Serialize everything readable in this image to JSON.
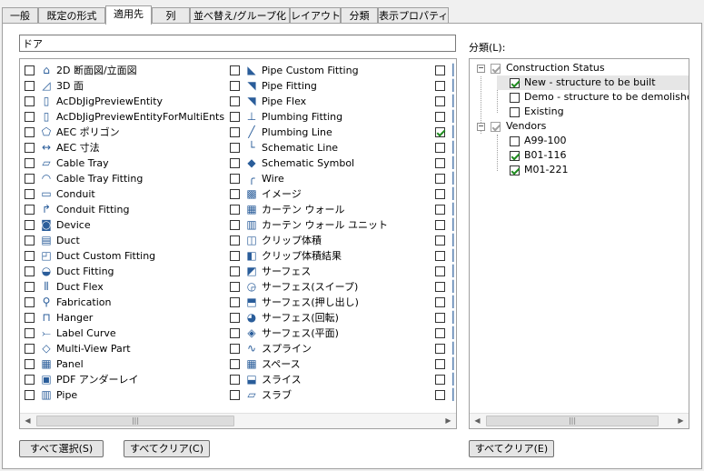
{
  "tabs": [
    {
      "label": "一般"
    },
    {
      "label": "既定の形式"
    },
    {
      "label": "適用先",
      "active": true
    },
    {
      "label": "列"
    },
    {
      "label": "並べ替え/グループ化"
    },
    {
      "label": "レイアウト"
    },
    {
      "label": "分類"
    },
    {
      "label": "表示プロパティ"
    }
  ],
  "search": {
    "value": "ドア"
  },
  "objects": {
    "col1": [
      {
        "label": "2D 断面図/立面図",
        "icon": "house-icon",
        "checked": false
      },
      {
        "label": "3D 面",
        "icon": "face-icon",
        "checked": false
      },
      {
        "label": "AcDbJigPreviewEntity",
        "icon": "document-icon",
        "checked": false
      },
      {
        "label": "AcDbJigPreviewEntityForMultiEnts",
        "icon": "document-icon",
        "checked": false
      },
      {
        "label": "AEC ポリゴン",
        "icon": "polygon-icon",
        "checked": false
      },
      {
        "label": "AEC 寸法",
        "icon": "dimension-icon",
        "checked": false
      },
      {
        "label": "Cable Tray",
        "icon": "cable-tray-icon",
        "checked": false
      },
      {
        "label": "Cable Tray Fitting",
        "icon": "cable-tray-fitting-icon",
        "checked": false
      },
      {
        "label": "Conduit",
        "icon": "conduit-icon",
        "checked": false
      },
      {
        "label": "Conduit Fitting",
        "icon": "conduit-fitting-icon",
        "checked": false
      },
      {
        "label": "Device",
        "icon": "device-icon",
        "checked": false
      },
      {
        "label": "Duct",
        "icon": "duct-icon",
        "checked": false
      },
      {
        "label": "Duct Custom Fitting",
        "icon": "duct-custom-fitting-icon",
        "checked": false
      },
      {
        "label": "Duct Fitting",
        "icon": "duct-fitting-icon",
        "checked": false
      },
      {
        "label": "Duct Flex",
        "icon": "duct-flex-icon",
        "checked": false
      },
      {
        "label": "Fabrication",
        "icon": "fabrication-icon",
        "checked": false
      },
      {
        "label": "Hanger",
        "icon": "hanger-icon",
        "checked": false
      },
      {
        "label": "Label Curve",
        "icon": "label-curve-icon",
        "checked": false
      },
      {
        "label": "Multi-View Part",
        "icon": "multi-view-part-icon",
        "checked": false
      },
      {
        "label": "Panel",
        "icon": "panel-icon",
        "checked": false
      },
      {
        "label": "PDF アンダーレイ",
        "icon": "pdf-icon",
        "checked": false
      },
      {
        "label": "Pipe",
        "icon": "pipe-icon",
        "checked": false
      }
    ],
    "col2": [
      {
        "label": "Pipe Custom Fitting",
        "icon": "pipe-custom-fitting-icon",
        "checked": false
      },
      {
        "label": "Pipe Fitting",
        "icon": "pipe-fitting-icon",
        "checked": false
      },
      {
        "label": "Pipe Flex",
        "icon": "pipe-flex-icon",
        "checked": false
      },
      {
        "label": "Plumbing Fitting",
        "icon": "plumbing-fitting-icon",
        "checked": false
      },
      {
        "label": "Plumbing Line",
        "icon": "plumbing-line-icon",
        "checked": false
      },
      {
        "label": "Schematic Line",
        "icon": "schematic-line-icon",
        "checked": false
      },
      {
        "label": "Schematic Symbol",
        "icon": "schematic-symbol-icon",
        "checked": false
      },
      {
        "label": "Wire",
        "icon": "wire-icon",
        "checked": false
      },
      {
        "label": "イメージ",
        "icon": "image-icon",
        "checked": false
      },
      {
        "label": "カーテン ウォール",
        "icon": "curtain-wall-icon",
        "checked": false
      },
      {
        "label": "カーテン ウォール ユニット",
        "icon": "curtain-wall-unit-icon",
        "checked": false
      },
      {
        "label": "クリップ体積",
        "icon": "clip-volume-icon",
        "checked": false
      },
      {
        "label": "クリップ体積結果",
        "icon": "clip-volume-result-icon",
        "checked": false
      },
      {
        "label": "サーフェス",
        "icon": "surface-icon",
        "checked": false
      },
      {
        "label": "サーフェス(スイープ)",
        "icon": "surface-sweep-icon",
        "checked": false
      },
      {
        "label": "サーフェス(押し出し)",
        "icon": "surface-extrude-icon",
        "checked": false
      },
      {
        "label": "サーフェス(回転)",
        "icon": "surface-revolve-icon",
        "checked": false
      },
      {
        "label": "サーフェス(平面)",
        "icon": "surface-planar-icon",
        "checked": false
      },
      {
        "label": "スプライン",
        "icon": "spline-icon",
        "checked": false
      },
      {
        "label": "スペース",
        "icon": "space-icon",
        "checked": false
      },
      {
        "label": "スライス",
        "icon": "slice-icon",
        "checked": false
      },
      {
        "label": "スラブ",
        "icon": "slab-icon",
        "checked": false
      }
    ],
    "col3": [
      {
        "icon": "partial-icon",
        "checked": false
      },
      {
        "icon": "partial-icon",
        "checked": false
      },
      {
        "icon": "partial-icon",
        "checked": false
      },
      {
        "icon": "partial-icon",
        "checked": false
      },
      {
        "icon": "partial-icon",
        "checked": true
      },
      {
        "icon": "partial-icon",
        "checked": false
      },
      {
        "icon": "partial-icon",
        "checked": false
      },
      {
        "icon": "partial-icon",
        "checked": false
      },
      {
        "icon": "partial-icon",
        "checked": false
      },
      {
        "icon": "partial-icon",
        "checked": false
      },
      {
        "icon": "partial-icon",
        "checked": false
      },
      {
        "icon": "partial-icon",
        "checked": false
      },
      {
        "icon": "partial-icon",
        "checked": false
      },
      {
        "icon": "partial-icon",
        "checked": false
      },
      {
        "icon": "partial-icon",
        "checked": false
      },
      {
        "icon": "partial-icon",
        "checked": false
      },
      {
        "icon": "partial-icon",
        "checked": false
      },
      {
        "icon": "partial-icon",
        "checked": false
      },
      {
        "icon": "partial-icon",
        "checked": false
      },
      {
        "icon": "partial-icon",
        "checked": false
      },
      {
        "icon": "partial-icon",
        "checked": false
      },
      {
        "icon": "partial-icon",
        "checked": false
      }
    ]
  },
  "classification": {
    "label": "分類(L):",
    "groups": [
      {
        "label": "Construction Status",
        "checked": true,
        "children": [
          {
            "label": "New - structure to be built",
            "checked": true
          },
          {
            "label": "Demo - structure to be demolished",
            "checked": false
          },
          {
            "label": "Existing",
            "checked": false
          }
        ]
      },
      {
        "label": "Vendors",
        "checked": true,
        "children": [
          {
            "label": "A99-100",
            "checked": false
          },
          {
            "label": "B01-116",
            "checked": true
          },
          {
            "label": "M01-221",
            "checked": true
          }
        ]
      }
    ]
  },
  "buttons": {
    "select_all": "すべて選択(S)",
    "clear_all": "すべてクリア(C)",
    "clear_all_classification": "すべてクリア(E)"
  }
}
